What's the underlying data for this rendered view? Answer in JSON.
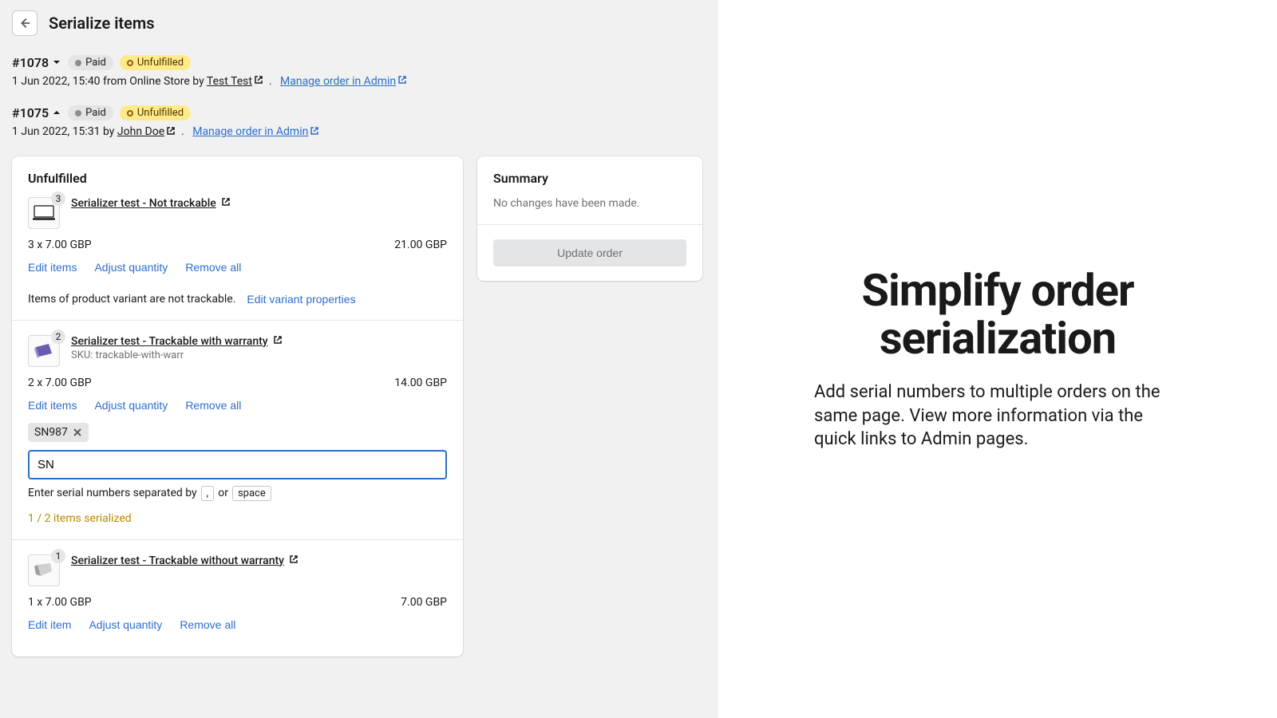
{
  "pageTitle": "Serialize items",
  "orders": [
    {
      "number": "#1078",
      "paidBadge": "Paid",
      "unfulfilledBadge": "Unfulfilled",
      "metaPrefix": "1 Jun 2022, 15:40 from Online Store by ",
      "author": "Test Test",
      "manageLink": "Manage order in Admin"
    },
    {
      "number": "#1075",
      "paidBadge": "Paid",
      "unfulfilledBadge": "Unfulfilled",
      "metaPrefix": "1 Jun 2022, 15:31 by ",
      "author": "John Doe",
      "manageLink": "Manage order in Admin"
    }
  ],
  "unfulfilledTitle": "Unfulfilled",
  "items": [
    {
      "qty": "3",
      "title": "Serializer test - Not trackable",
      "priceLeft": "3 x 7.00 GBP",
      "priceRight": "21.00 GBP",
      "editItems": "Edit items",
      "adjustQty": "Adjust quantity",
      "removeAll": "Remove all",
      "note": "Items of product variant are not trackable.",
      "editVariant": "Edit variant properties"
    },
    {
      "qty": "2",
      "title": "Serializer test - Trackable with warranty",
      "sku": "SKU: trackable-with-warr",
      "priceLeft": "2 x 7.00 GBP",
      "priceRight": "14.00 GBP",
      "editItems": "Edit items",
      "adjustQty": "Adjust quantity",
      "removeAll": "Remove all",
      "tag": "SN987",
      "inputValue": "SN",
      "helpPrefix": "Enter serial numbers separated by",
      "helpComma": ",",
      "helpOr": "or",
      "helpSpace": "space",
      "serializedCount": "1 / 2 items serialized"
    },
    {
      "qty": "1",
      "title": "Serializer test - Trackable without warranty",
      "priceLeft": "1 x 7.00 GBP",
      "priceRight": "7.00 GBP",
      "editItem": "Edit item",
      "adjustQty": "Adjust quantity",
      "removeAll": "Remove all"
    }
  ],
  "summary": {
    "title": "Summary",
    "body": "No changes have been made.",
    "updateBtn": "Update order"
  },
  "promo": {
    "title": "Simplify order serialization",
    "sub": "Add serial numbers to multiple orders on the same page. View more information via the quick links to Admin pages."
  }
}
